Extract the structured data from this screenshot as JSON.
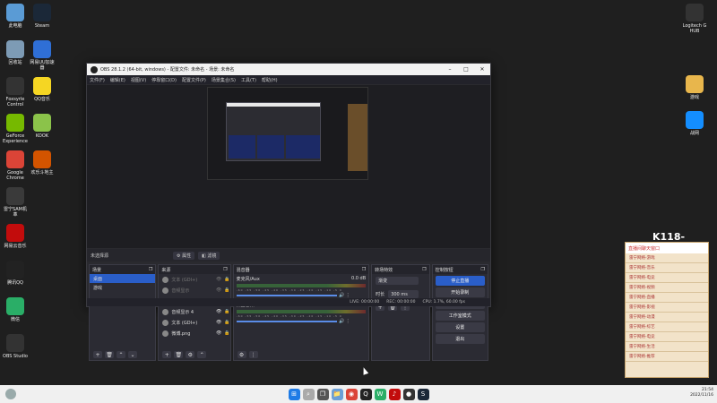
{
  "desktop": {
    "left_icons": [
      {
        "label": "此电脑",
        "icon": "computer-icon",
        "color": "#5a9bd5"
      },
      {
        "label": "回收站",
        "icon": "recycle-bin-icon",
        "color": "#7d9bb5"
      },
      {
        "label": "Foxsyrle Control",
        "icon": "foxsyrle-icon",
        "color": "#333333"
      },
      {
        "label": "GeForce Experience",
        "icon": "geforce-icon",
        "color": "#76b900"
      },
      {
        "label": "Google Chrome",
        "icon": "chrome-icon",
        "color": "#db4437"
      },
      {
        "label": "雷宁SAM机革",
        "icon": "leining-icon",
        "color": "#3a3a3a"
      },
      {
        "label": "网易云音乐",
        "icon": "netease-music-icon",
        "color": "#c20c0c"
      },
      {
        "label": "腾讯QQ",
        "icon": "qq-icon",
        "color": "#222222"
      },
      {
        "label": "微信",
        "icon": "wechat-icon",
        "color": "#2aae67"
      },
      {
        "label": "OBS Studio",
        "icon": "obs-icon",
        "color": "#333333"
      }
    ],
    "mid_icons": [
      {
        "label": "Steam",
        "icon": "steam-icon",
        "color": "#1b2838"
      },
      {
        "label": "网易UU加速器",
        "icon": "uu-icon",
        "color": "#2f6fd6"
      },
      {
        "label": "QQ音乐",
        "icon": "qq-music-icon",
        "color": "#f5d623"
      },
      {
        "label": "KOOK",
        "icon": "kook-icon",
        "color": "#8bc34a"
      },
      {
        "label": "欢乐斗地主",
        "icon": "doudizhu-icon",
        "color": "#d35400"
      }
    ],
    "right_icons": [
      {
        "label": "Logitech G HUB",
        "icon": "logitech-icon",
        "color": "#333333"
      },
      {
        "label": "游戏",
        "icon": "folder-icon",
        "color": "#e8b64c"
      },
      {
        "label": "战网",
        "icon": "battlenet-icon",
        "color": "#148eff"
      }
    ]
  },
  "obs": {
    "title": "OBS 28.1.2 (64-bit, windows) - 配置文件: 未命名 - 场景: 未命名",
    "menus": [
      "文件(F)",
      "编辑(E)",
      "视图(V)",
      "停靠窗口(D)",
      "配置文件(P)",
      "场景集合(S)",
      "工具(T)",
      "帮助(H)"
    ],
    "source_bar": {
      "label": "未选择源",
      "props": "属性",
      "filters": "滤镜"
    },
    "docks": {
      "scenes": {
        "title": "场景",
        "items": [
          "桌面",
          "游戏"
        ]
      },
      "sources": {
        "title": "来源",
        "items": [
          {
            "name": "文本 (GDI+)",
            "dim": true
          },
          {
            "name": "音频显示",
            "dim": true
          },
          {
            "name": "浏览器",
            "dim": false
          },
          {
            "name": "音频显示 4",
            "dim": false
          },
          {
            "name": "文本 (GDI+)",
            "dim": false
          },
          {
            "name": "微博.png",
            "dim": false
          }
        ]
      },
      "mixer": {
        "title": "混音器",
        "channels": [
          {
            "name": "麦克风/Aux",
            "db": "0.0 dB"
          },
          {
            "name": "桌面音频",
            "db": "0.0 dB"
          }
        ],
        "ticks": "-60 -55 -50 -45 -40 -35 -30 -25 -20 -15 -10 -5 0"
      },
      "transitions": {
        "title": "转场特效",
        "selected": "渐变",
        "duration_label": "时长",
        "duration": "300 ms"
      },
      "controls": {
        "title": "控制按钮",
        "buttons": [
          "停止直播",
          "开始录制",
          "启动虚拟摄像机",
          "工作室模式",
          "设置",
          "退出"
        ]
      }
    },
    "status": {
      "live": "LIVE: 00:00:00",
      "rec": "REC: 00:00:00",
      "cpu": "CPU: 1.7%, 60.00 fps"
    }
  },
  "stream_panel": {
    "header": "K118-",
    "subtitle": "直播间聊天窗口",
    "rows": [
      "雷宁网络-游戏",
      "雷宁网络-音乐",
      "雷宁网络-电竞",
      "雷宁网络-视频",
      "雷宁网络-直播",
      "雷宁网络-影视",
      "雷宁网络-动漫",
      "雷宁网络-综艺",
      "雷宁网络-电竞",
      "雷宁网络-生活",
      "雷宁网络-推荐"
    ]
  },
  "taskbar": {
    "time": "21:54",
    "date": "2022/11/16"
  }
}
